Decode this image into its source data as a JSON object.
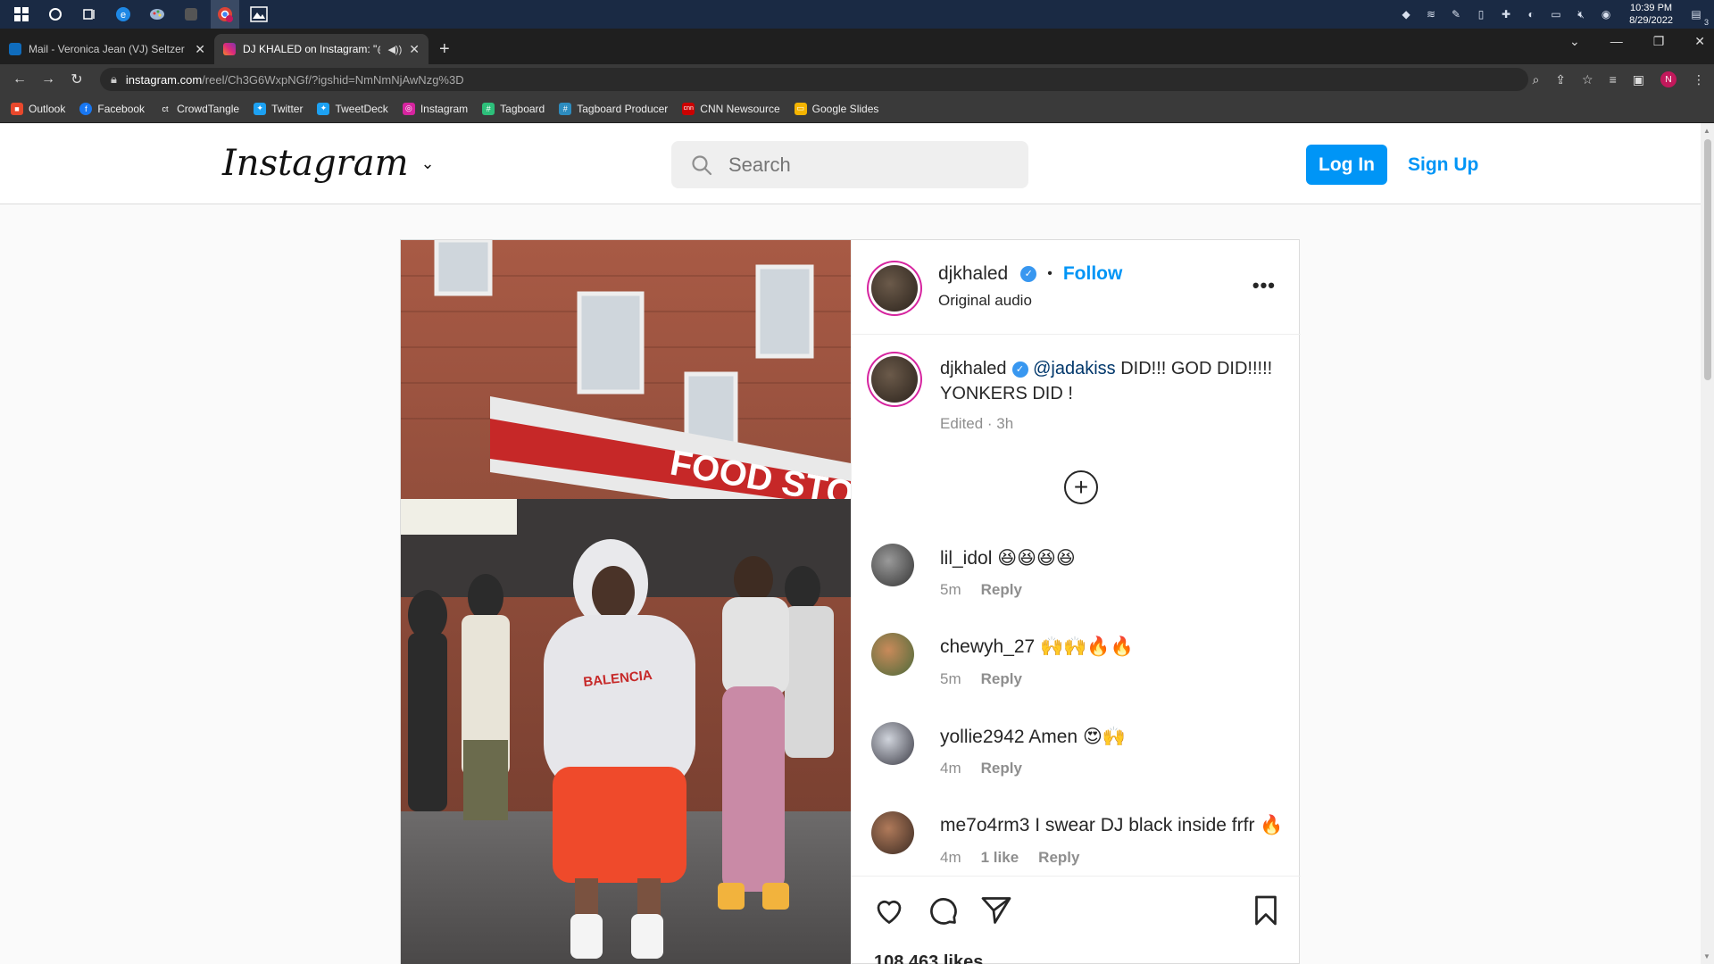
{
  "taskbar": {
    "clock_time": "10:39 PM",
    "clock_date": "8/29/2022",
    "notification_count": "3"
  },
  "browser": {
    "tabs": [
      {
        "title": "Mail - Veronica Jean (VJ) Seltzer",
        "favicon_color": "#0f6cbd"
      },
      {
        "title": "DJ KHALED on Instagram: \"@",
        "favicon_color": "#e1306c"
      }
    ],
    "url_host": "instagram.com",
    "url_path": "/reel/Ch3G6WxpNGf/?igshid=NmNmNjAwNzg%3D",
    "profile_letter": "N",
    "bookmarks": [
      {
        "label": "Outlook",
        "color": "#e8482c",
        "glyph": "■"
      },
      {
        "label": "Facebook",
        "color": "#1877f2",
        "glyph": "f"
      },
      {
        "label": "CrowdTangle",
        "color": "#3a3a3a",
        "glyph": "ct"
      },
      {
        "label": "Twitter",
        "color": "#1da1f2",
        "glyph": "✦"
      },
      {
        "label": "TweetDeck",
        "color": "#1da1f2",
        "glyph": "✦"
      },
      {
        "label": "Instagram",
        "color": "#d6249f",
        "glyph": "◎"
      },
      {
        "label": "Tagboard",
        "color": "#2dbf7a",
        "glyph": "#"
      },
      {
        "label": "Tagboard Producer",
        "color": "#2d8cbf",
        "glyph": "#"
      },
      {
        "label": "CNN Newsource",
        "color": "#cc0000",
        "glyph": "cnn"
      },
      {
        "label": "Google Slides",
        "color": "#f4b400",
        "glyph": "▭"
      }
    ]
  },
  "instagram": {
    "search_placeholder": "Search",
    "login_label": "Log In",
    "signup_label": "Sign Up",
    "post": {
      "author": "djkhaled",
      "follow_label": "Follow",
      "audio": "Original audio",
      "caption_mention": "@jadakiss",
      "caption_text": " DID!!! GOD DID!!!!! YONKERS DID !",
      "caption_meta": "Edited · 3h",
      "likes": "108,463 likes"
    },
    "comments": [
      {
        "user": "lil_idol",
        "text": " 😆😆😆😆",
        "time": "5m",
        "likes": "",
        "reply": "Reply"
      },
      {
        "user": "chewyh_27",
        "text": " 🙌🙌🔥🔥",
        "time": "5m",
        "likes": "",
        "reply": "Reply"
      },
      {
        "user": "yollie2942",
        "text": " Amen 😍🙌",
        "time": "4m",
        "likes": "",
        "reply": "Reply"
      },
      {
        "user": "me7o4rm3",
        "text": " I swear DJ black inside frfr 🔥",
        "time": "4m",
        "likes": "1 like",
        "reply": "Reply"
      }
    ]
  }
}
